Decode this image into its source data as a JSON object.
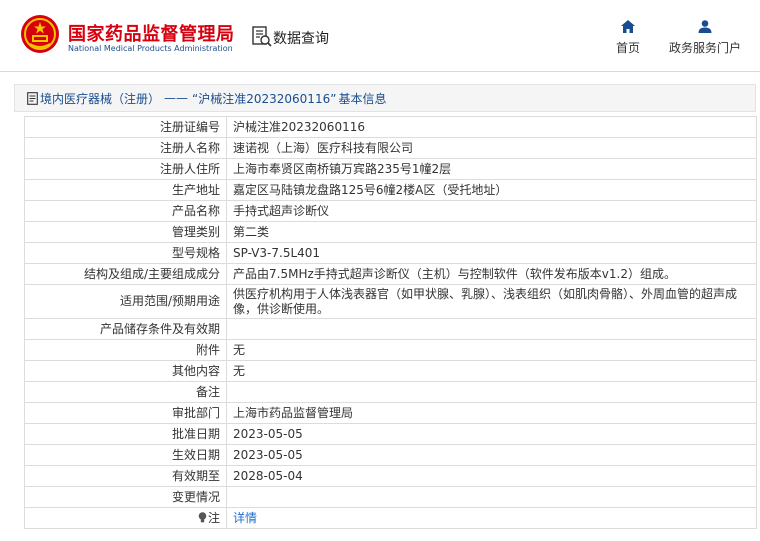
{
  "header": {
    "brand_cn": "国家药品监督管理局",
    "brand_en": "National Medical Products Administration",
    "query_title": "数据查询",
    "nav": [
      {
        "label": "首页",
        "icon": "home-icon"
      },
      {
        "label": "政务服务门户",
        "icon": "user-icon"
      }
    ]
  },
  "title_bar": {
    "category": "境内医疗器械（注册）",
    "separator": "——",
    "cert_quoted": "“沪械注准20232060116”",
    "suffix": "基本信息"
  },
  "colors": {
    "brand_red": "#d7000f",
    "nav_blue": "#1a4d8f",
    "link_blue": "#1f6fd1",
    "border": "#dcdcdc"
  },
  "rows": [
    {
      "label": "注册证编号",
      "value": "沪械注准20232060116"
    },
    {
      "label": "注册人名称",
      "value": "速诺视（上海）医疗科技有限公司"
    },
    {
      "label": "注册人住所",
      "value": "上海市奉贤区南桥镇万宾路235号1幢2层"
    },
    {
      "label": "生产地址",
      "value": "嘉定区马陆镇龙盘路125号6幢2楼A区（受托地址）"
    },
    {
      "label": "产品名称",
      "value": "手持式超声诊断仪"
    },
    {
      "label": "管理类别",
      "value": "第二类"
    },
    {
      "label": "型号规格",
      "value": "SP-V3-7.5L401"
    },
    {
      "label": "结构及组成/主要组成成分",
      "value": "产品由7.5MHz手持式超声诊断仪（主机）与控制软件（软件发布版本v1.2）组成。"
    },
    {
      "label": "适用范围/预期用途",
      "value": "供医疗机构用于人体浅表器官（如甲状腺、乳腺）、浅表组织（如肌肉骨骼）、外周血管的超声成像，供诊断使用。"
    },
    {
      "label": "产品储存条件及有效期",
      "value": ""
    },
    {
      "label": "附件",
      "value": "无"
    },
    {
      "label": "其他内容",
      "value": "无"
    },
    {
      "label": "备注",
      "value": ""
    },
    {
      "label": "审批部门",
      "value": "上海市药品监督管理局"
    },
    {
      "label": "批准日期",
      "value": "2023-05-05"
    },
    {
      "label": "生效日期",
      "value": "2023-05-05"
    },
    {
      "label": "有效期至",
      "value": "2028-05-04"
    },
    {
      "label": "变更情况",
      "value": ""
    },
    {
      "label": "注",
      "value": "详情"
    }
  ]
}
